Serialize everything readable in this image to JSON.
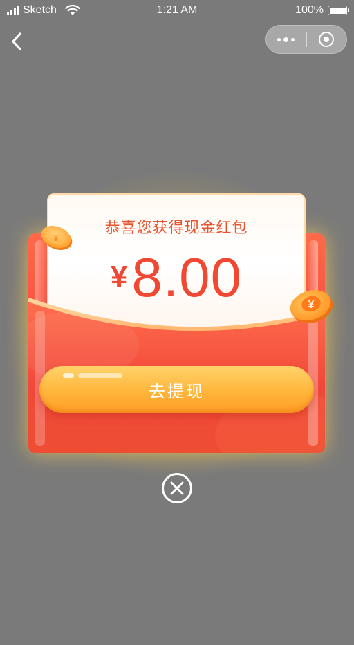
{
  "status_bar": {
    "carrier": "Sketch",
    "time": "1:21 AM",
    "battery_label": "100%",
    "battery_level": 1.0
  },
  "nav": {
    "back_icon": "chevron-left-icon",
    "menu_icon": "more-dots-icon",
    "close_mini_icon": "target-icon"
  },
  "red_packet": {
    "title": "恭喜您获得现金红包",
    "currency": "¥",
    "amount": "8.00",
    "button_label": "去提现",
    "coin_symbol": "¥"
  },
  "close": {
    "icon": "close-circle-icon"
  },
  "colors": {
    "backdrop": "#7a7a7a",
    "accent_red": "#f04832",
    "button_gold": "#ffb53b",
    "coin_gold": "#ffa12a"
  }
}
